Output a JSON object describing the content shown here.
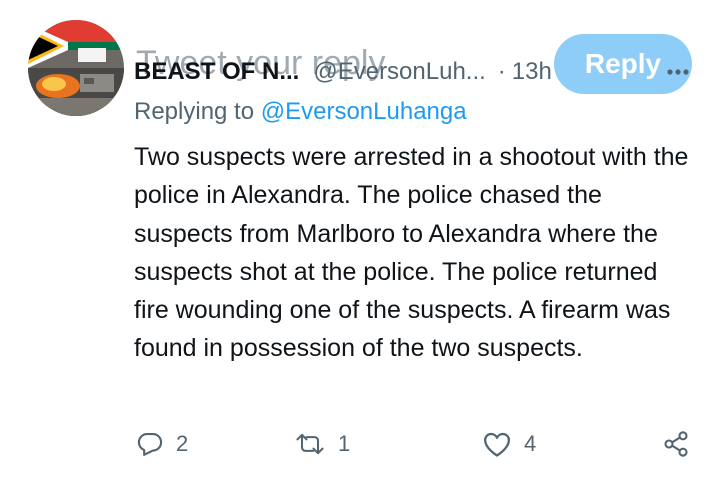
{
  "ghost": {
    "compose_placeholder": "Tweet your reply",
    "reply_button_label": "Reply"
  },
  "tweet": {
    "display_name": "BEAST OF N...",
    "handle": "@EversonLuh...",
    "separator": "·",
    "time": "13h",
    "replying_prefix": "Replying to ",
    "replying_to": "@EversonLuhanga",
    "text": "Two suspects were arrested in a shootout with the police in Alexandra. The police chased the suspects from Marlboro to Alexandra where the suspects shot at the police. The police returned fire wounding one of the suspects. A firearm was found in possession of the two suspects.",
    "reply_count": "2",
    "retweet_count": "1",
    "like_count": "4"
  },
  "icons": {
    "more": "more-horizontal-icon",
    "reply": "reply-bubble-icon",
    "retweet": "retweet-icon",
    "like": "heart-icon",
    "share": "share-icon"
  },
  "colors": {
    "text": "#0f1419",
    "muted": "#536471",
    "accent": "#1d9bf0",
    "ghost_button": "#8ecdf7"
  }
}
